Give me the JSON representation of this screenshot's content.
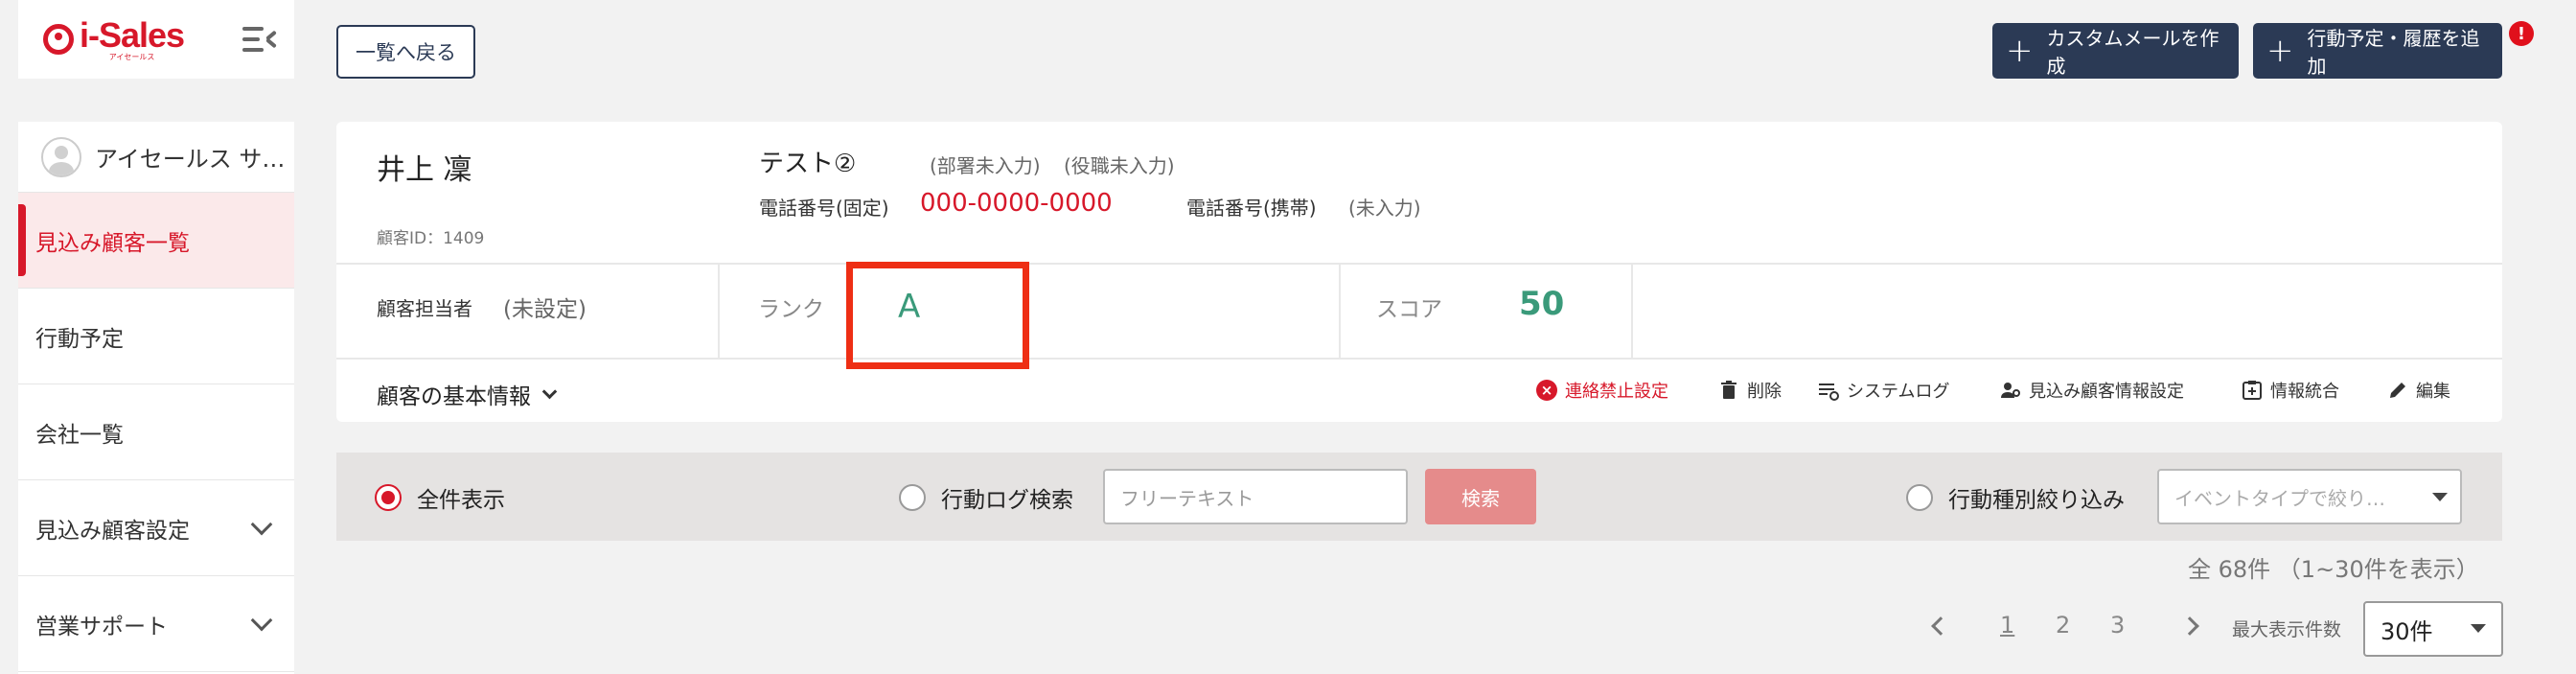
{
  "brand": {
    "name": "i-Sales",
    "subtitle": "アイセールス",
    "color": "#d7182a"
  },
  "sidebar": {
    "user": "アイセールス サ…",
    "items": [
      {
        "label": "見込み顧客一覧",
        "active": true
      },
      {
        "label": "行動予定"
      },
      {
        "label": "会社一覧"
      },
      {
        "label": "見込み顧客設定",
        "expandable": true
      },
      {
        "label": "営業サポート",
        "expandable": true
      }
    ]
  },
  "header": {
    "back_label": "一覧へ戻る",
    "create_mail_label": "カスタムメールを作成",
    "add_action_label": "行動予定・履歴を追加",
    "alert_badge": "!"
  },
  "customer": {
    "name": "井上 凜",
    "id": "顧客ID：1409",
    "company": "テスト②",
    "department": "(部署未入力)",
    "position": "(役職未入力)",
    "tel_label": "電話番号(固定)",
    "tel_value": "000-0000-0000",
    "mobile_label": "電話番号(携帯)",
    "mobile_value": "(未入力)",
    "owner_label": "顧客担当者",
    "owner_value": "(未設定)",
    "rank_label": "ランク",
    "rank_value": "A",
    "score_label": "スコア",
    "score_value": "50"
  },
  "basic_info": {
    "label": "顧客の基本情報",
    "actions": {
      "no_contact": "連絡禁止設定",
      "delete": "削除",
      "system_log": "システムログ",
      "prospect_settings": "見込み顧客情報設定",
      "merge": "情報統合",
      "edit": "編集"
    }
  },
  "search": {
    "show_all": "全件表示",
    "log_search": "行動ログ検索",
    "free_text_placeholder": "フリーテキスト",
    "search_button": "検索",
    "type_filter": "行動種別絞り込み",
    "event_type_placeholder": "イベントタイプで絞り…"
  },
  "list": {
    "count": "全 68件 （1~30件を表示）",
    "pages": [
      "1",
      "2",
      "3"
    ],
    "current_page": "1",
    "max_label": "最大表示件数",
    "per_page": "30件"
  }
}
